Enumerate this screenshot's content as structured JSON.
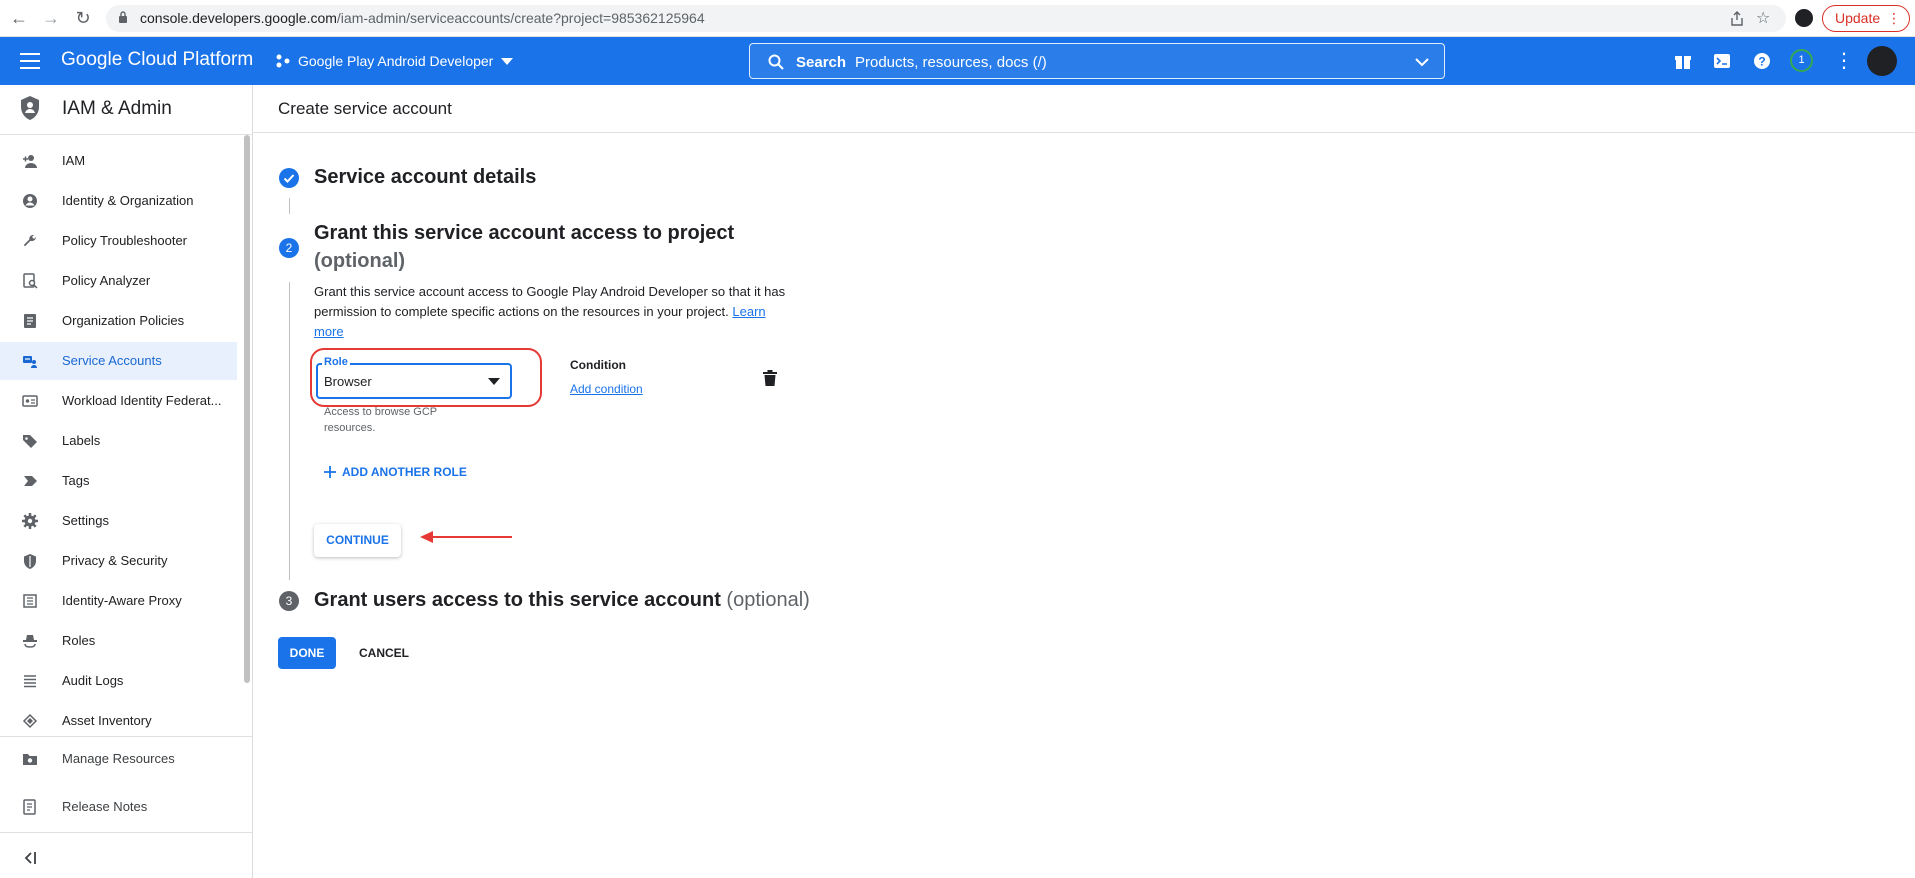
{
  "browser": {
    "url_host": "console.developers.google.com",
    "url_path": "/iam-admin/serviceaccounts/create?project=985362125964",
    "update_label": "Update"
  },
  "header": {
    "brand": "Google Cloud Platform",
    "project": "Google Play Android Developer",
    "search_label": "Search",
    "search_placeholder": "Products, resources, docs (/)",
    "notification_count": "1"
  },
  "sidebar": {
    "title": "IAM & Admin",
    "items": [
      {
        "label": "IAM",
        "icon": "person-add-icon"
      },
      {
        "label": "Identity & Organization",
        "icon": "account-circle-icon"
      },
      {
        "label": "Policy Troubleshooter",
        "icon": "wrench-icon"
      },
      {
        "label": "Policy Analyzer",
        "icon": "policy-analyzer-icon"
      },
      {
        "label": "Organization Policies",
        "icon": "document-icon"
      },
      {
        "label": "Service Accounts",
        "icon": "service-account-icon",
        "active": true
      },
      {
        "label": "Workload Identity Federat...",
        "icon": "id-card-icon"
      },
      {
        "label": "Labels",
        "icon": "label-icon"
      },
      {
        "label": "Tags",
        "icon": "tag-icon"
      },
      {
        "label": "Settings",
        "icon": "gear-icon"
      },
      {
        "label": "Privacy & Security",
        "icon": "shield-icon"
      },
      {
        "label": "Identity-Aware Proxy",
        "icon": "proxy-icon"
      },
      {
        "label": "Roles",
        "icon": "roles-icon"
      },
      {
        "label": "Audit Logs",
        "icon": "list-icon"
      },
      {
        "label": "Asset Inventory",
        "icon": "asset-icon"
      }
    ],
    "bottom_items": [
      {
        "label": "Manage Resources",
        "icon": "folder-gear-icon"
      },
      {
        "label": "Release Notes",
        "icon": "notes-icon"
      }
    ]
  },
  "main": {
    "page_title": "Create service account",
    "step1": {
      "title": "Service account details"
    },
    "step2": {
      "number": "2",
      "title": "Grant this service account access to project",
      "optional": "(optional)",
      "description": "Grant this service account access to Google Play Android Developer so that it has permission to complete specific actions on the resources in your project.",
      "learn_more": "Learn more",
      "role_label": "Role",
      "role_value": "Browser",
      "role_helper": "Access to browse GCP resources.",
      "condition_label": "Condition",
      "add_condition": "Add condition",
      "add_role": "ADD ANOTHER ROLE",
      "continue": "CONTINUE"
    },
    "step3": {
      "number": "3",
      "title": "Grant users access to this service account",
      "optional": "(optional)"
    },
    "done": "DONE",
    "cancel": "CANCEL"
  },
  "colors": {
    "accent": "#1a73e8",
    "annotation": "#e53935"
  }
}
